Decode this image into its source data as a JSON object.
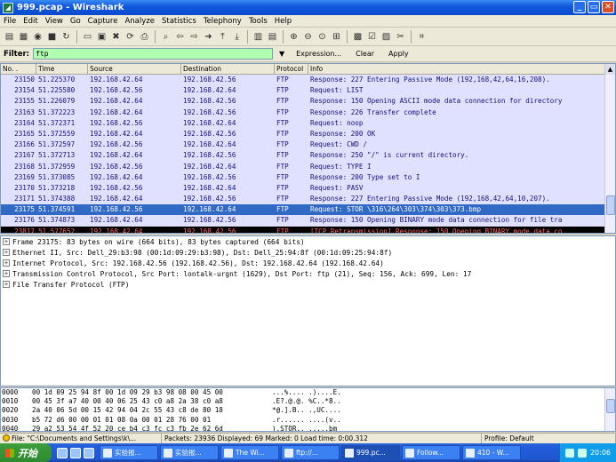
{
  "window": {
    "title": "999.pcap - Wireshark"
  },
  "menu": [
    "File",
    "Edit",
    "View",
    "Go",
    "Capture",
    "Analyze",
    "Statistics",
    "Telephony",
    "Tools",
    "Help"
  ],
  "filter": {
    "label": "Filter:",
    "value": "ftp",
    "expression": "Expression...",
    "clear": "Clear",
    "apply": "Apply"
  },
  "packet_list": {
    "columns": [
      "No. .",
      "Time",
      "Source",
      "Destination",
      "Protocol",
      "Info"
    ],
    "rows": [
      {
        "no": "23150",
        "time": "51.225370",
        "src": "192.168.42.64",
        "dst": "192.168.42.56",
        "proto": "FTP",
        "info": "Response: 227 Entering Passive Mode (192,168,42,64,16,208).",
        "style": "ftp"
      },
      {
        "no": "23154",
        "time": "51.225580",
        "src": "192.168.42.56",
        "dst": "192.168.42.64",
        "proto": "FTP",
        "info": "Request: LIST",
        "style": "ftp"
      },
      {
        "no": "23155",
        "time": "51.226079",
        "src": "192.168.42.64",
        "dst": "192.168.42.56",
        "proto": "FTP",
        "info": "Response: 150 Opening ASCII mode data connection for directory",
        "style": "ftp"
      },
      {
        "no": "23163",
        "time": "51.372223",
        "src": "192.168.42.64",
        "dst": "192.168.42.56",
        "proto": "FTP",
        "info": "Response: 226 Transfer complete",
        "style": "ftp"
      },
      {
        "no": "23164",
        "time": "51.372371",
        "src": "192.168.42.56",
        "dst": "192.168.42.64",
        "proto": "FTP",
        "info": "Request: noop",
        "style": "ftp"
      },
      {
        "no": "23165",
        "time": "51.372559",
        "src": "192.168.42.64",
        "dst": "192.168.42.56",
        "proto": "FTP",
        "info": "Response: 200 OK",
        "style": "ftp"
      },
      {
        "no": "23166",
        "time": "51.372597",
        "src": "192.168.42.56",
        "dst": "192.168.42.64",
        "proto": "FTP",
        "info": "Request: CWD /",
        "style": "ftp"
      },
      {
        "no": "23167",
        "time": "51.372713",
        "src": "192.168.42.64",
        "dst": "192.168.42.56",
        "proto": "FTP",
        "info": "Response: 250 \"/\" is current directory.",
        "style": "ftp"
      },
      {
        "no": "23168",
        "time": "51.372959",
        "src": "192.168.42.56",
        "dst": "192.168.42.64",
        "proto": "FTP",
        "info": "Request: TYPE I",
        "style": "ftp"
      },
      {
        "no": "23169",
        "time": "51.373085",
        "src": "192.168.42.64",
        "dst": "192.168.42.56",
        "proto": "FTP",
        "info": "Response: 200 Type set to I",
        "style": "ftp"
      },
      {
        "no": "23170",
        "time": "51.373218",
        "src": "192.168.42.56",
        "dst": "192.168.42.64",
        "proto": "FTP",
        "info": "Request: PASV",
        "style": "ftp"
      },
      {
        "no": "23171",
        "time": "51.374388",
        "src": "192.168.42.64",
        "dst": "192.168.42.56",
        "proto": "FTP",
        "info": "Response: 227 Entering Passive Mode (192,168,42,64,10,207).",
        "style": "ftp"
      },
      {
        "no": "23175",
        "time": "51.374591",
        "src": "192.168.42.56",
        "dst": "192.168.42.64",
        "proto": "FTP",
        "info": "Request: STOR \\316\\264\\303\\374\\303\\373.bmp",
        "style": "sel"
      },
      {
        "no": "23176",
        "time": "51.374873",
        "src": "192.168.42.64",
        "dst": "192.168.42.56",
        "proto": "FTP",
        "info": "Response: 150 Opening BINARY mode data connection for file tra",
        "style": "ftp"
      },
      {
        "no": "23817",
        "time": "51.577652",
        "src": "192.168.42.64",
        "dst": "192.168.42.56",
        "proto": "FTP",
        "info": "[TCP Retransmission] Response: 150 Opening BINARY mode data co",
        "style": "bad"
      }
    ]
  },
  "details": [
    "Frame 23175: 83 bytes on wire (664 bits), 83 bytes captured (664 bits)",
    "Ethernet II, Src: Dell_29:b3:98 (00:1d:09:29:b3:98), Dst: Dell_25:94:8f (00:1d:09:25:94:8f)",
    "Internet Protocol, Src: 192.168.42.56 (192.168.42.56), Dst: 192.168.42.64 (192.168.42.64)",
    "Transmission Control Protocol, Src Port: lontalk-urgnt (1629), Dst Port: ftp (21), Seq: 156, Ack: 699, Len: 17",
    "File Transfer Protocol (FTP)"
  ],
  "hex": [
    {
      "off": "0000",
      "bytes": "00 1d 09 25 94 8f 00 1d  09 29 b3 98 08 00 45 00",
      "ascii": "...%.... .)....E."
    },
    {
      "off": "0010",
      "bytes": "00 45 3f a7 40 00 40 06  25 43 c0 a8 2a 38 c0 a8",
      "ascii": ".E?.@.@. %C..*8.."
    },
    {
      "off": "0020",
      "bytes": "2a 40 06 5d 00 15 42 94  04 2c 55 43 c8 de 80 18",
      "ascii": "*@.].B.. .,UC...."
    },
    {
      "off": "0030",
      "bytes": "b5 72 d6 00 00 01 01  08 0a 00 01 28 76 00 01",
      "ascii": ".r...... ....(v.."
    },
    {
      "off": "0040",
      "bytes": "29 a2 53 54 4f 52 20 ce  b4 c3 fc c3 fb 2e 62 6d",
      "ascii": ").STOR.. .....bm"
    }
  ],
  "status": {
    "file": "File: \"C:\\Documents and Settings\\k\\...",
    "packets": "Packets: 23936 Displayed: 69 Marked: 0 Load time: 0:00.312",
    "profile": "Profile: Default"
  },
  "taskbar": {
    "start": "开始",
    "tasks": [
      "实验报...",
      "实验报...",
      "The Wi...",
      "ftp://...",
      "999.pc...",
      "Follow...",
      "410 - W..."
    ],
    "active_index": 4,
    "clock": "20:06"
  }
}
